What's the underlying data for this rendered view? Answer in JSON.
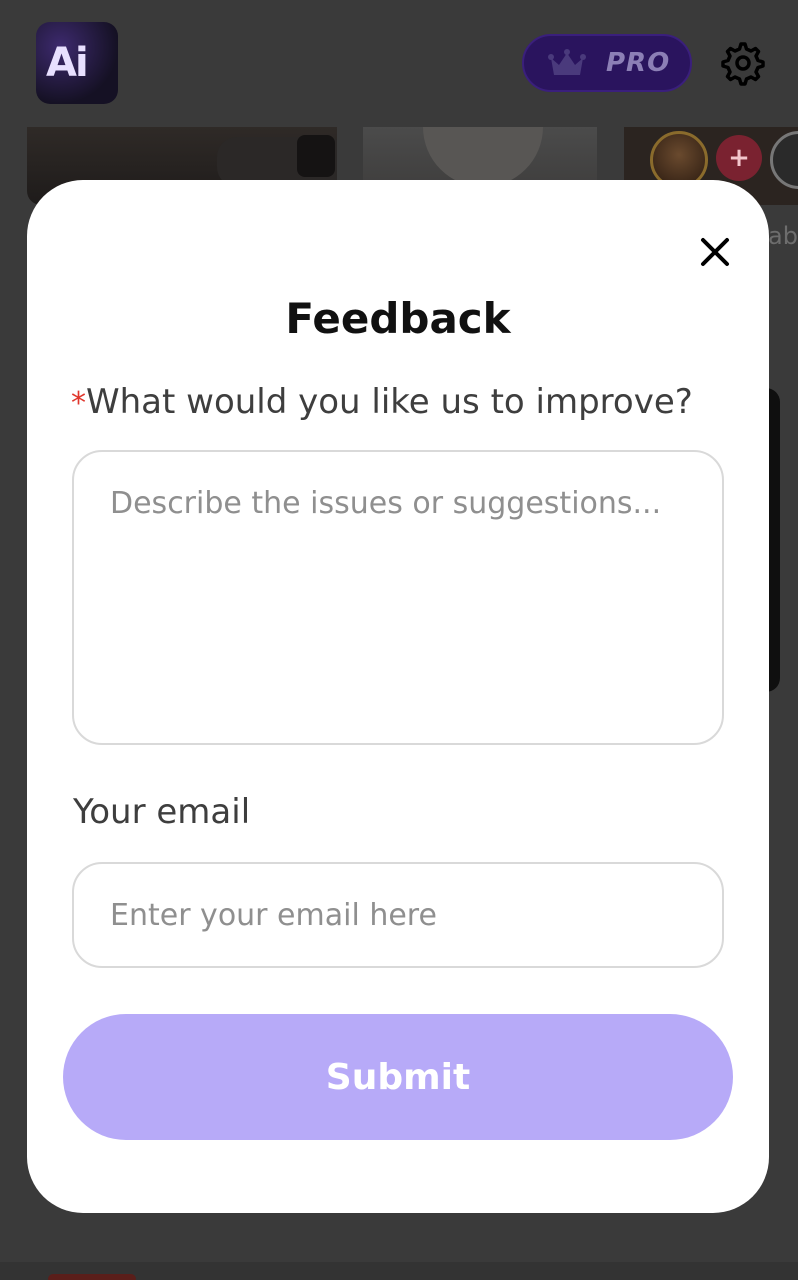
{
  "header": {
    "logo_text": "Ai",
    "pro_label": "PRO"
  },
  "background": {
    "partial_text": "ab"
  },
  "modal": {
    "title": "Feedback",
    "question": {
      "required_mark": "*",
      "label": "What would you like us to improve?",
      "placeholder": "Describe the issues or suggestions...",
      "value": ""
    },
    "email": {
      "label": "Your email",
      "placeholder": "Enter your email here",
      "value": ""
    },
    "submit_label": "Submit"
  },
  "colors": {
    "submit_bg": "#b7aaf8",
    "required": "#e0362c",
    "pro_bg": "#2a145e"
  },
  "icons": [
    "crown-icon",
    "settings-gear-icon",
    "close-icon",
    "heart-plus-icon"
  ]
}
